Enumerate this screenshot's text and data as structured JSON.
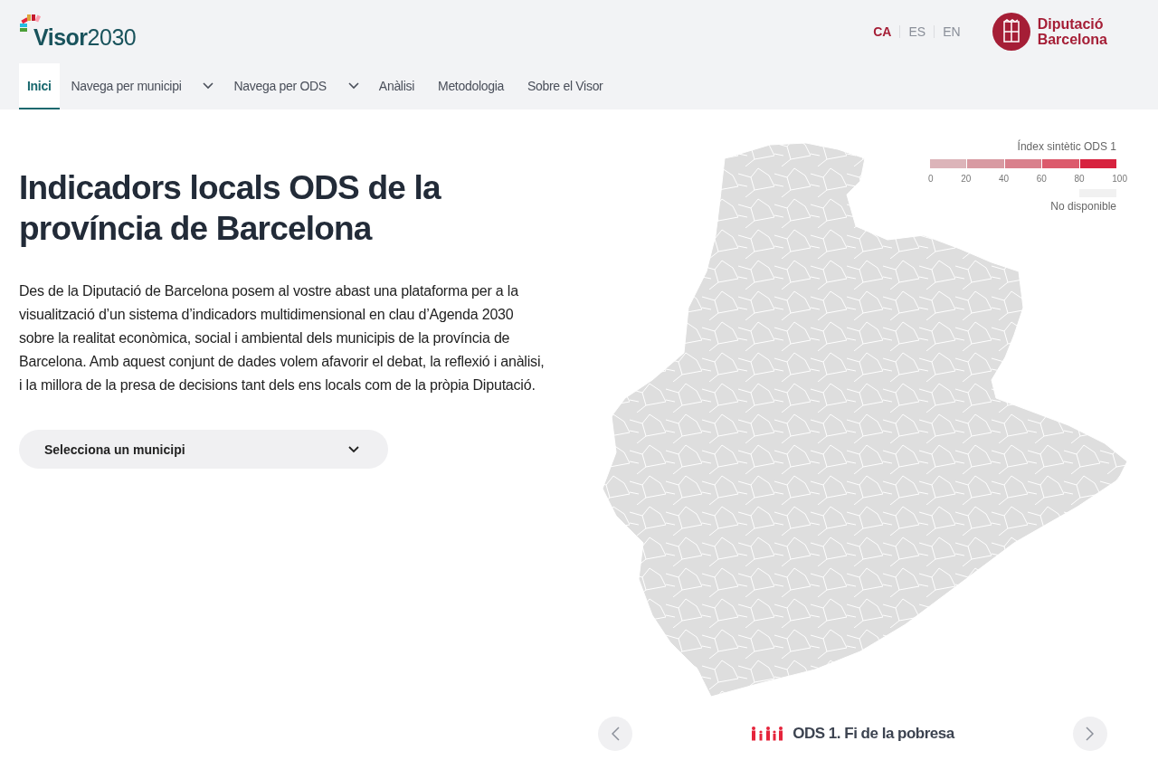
{
  "header": {
    "logo": {
      "text_bold": "Visor",
      "text_light": "2030"
    },
    "languages": [
      {
        "label": "CA",
        "selected": true
      },
      {
        "label": "ES",
        "selected": false
      },
      {
        "label": "EN",
        "selected": false
      }
    ],
    "institution": {
      "line_1": "Diputació",
      "line_2": "Barcelona"
    }
  },
  "nav": [
    {
      "label": "Inici",
      "selected": true,
      "dropdown": false
    },
    {
      "label": "Navega per municipi",
      "selected": false,
      "dropdown": true
    },
    {
      "label": "Navega per ODS",
      "selected": false,
      "dropdown": true
    },
    {
      "label": "Anàlisi",
      "selected": false,
      "dropdown": false
    },
    {
      "label": "Metodologia",
      "selected": false,
      "dropdown": false
    },
    {
      "label": "Sobre el Visor",
      "selected": false,
      "dropdown": false
    }
  ],
  "intro": {
    "title": "Indicadors locals ODS de la província de Barcelona",
    "body": "Des de la Diputació de Barcelona posem al vostre abast una plataforma per a la visualització d’un sistema d’indicadors multidimensional en clau d’Agenda 2030 sobre la realitat econòmica, social i ambiental dels municipis de la província de Barcelona. Amb aquest conjunt de dades volem afavorir el debat, la reflexió i anàlisi, i la millora de la presa de decisions tant dels ens locals com de la pròpia Diputació.",
    "select": {
      "placeholder": "Selecciona un municipi"
    }
  },
  "legend": {
    "title": "Índex sintètic ODS 1",
    "segments": [
      {
        "color": "#dcb4b9"
      },
      {
        "color": "#d89aa2"
      },
      {
        "color": "#d9808c"
      },
      {
        "color": "#dc5a6c"
      },
      {
        "color": "#d7223e"
      }
    ],
    "ticks": [
      "0",
      "20",
      "40",
      "60",
      "80",
      "100"
    ],
    "no_data": {
      "color": "#f1f1f1",
      "label": "No disponible"
    }
  },
  "carousel": {
    "title": "ODS 1. Fi de la pobresa"
  }
}
